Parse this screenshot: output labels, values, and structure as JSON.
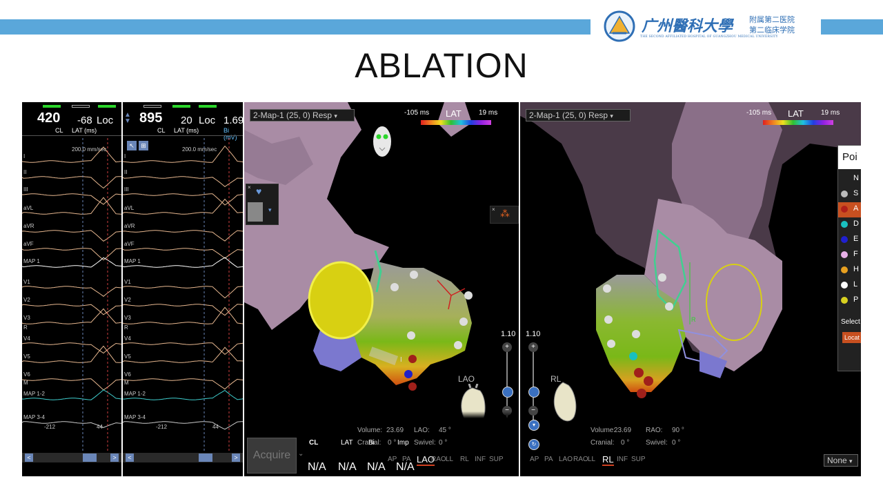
{
  "slide": {
    "title": "ABLATION",
    "logo": {
      "cn_name": "广州醫科大學",
      "cn_sub1": "附属第二医院",
      "cn_sub2": "第二临床学院",
      "en_sub": "THE SECOND AFFILIATED HOSPITAL OF GUANGZHOU MEDICAL UNIVERSITY"
    }
  },
  "ecg_left": {
    "cl_value": "420",
    "cl_label": "CL",
    "lat_value": "-68",
    "lat_label": "LAT (ms)",
    "loc_label": "Loc",
    "speed": "200.0 mm/sec",
    "leads": [
      "I",
      "II",
      "III",
      "aVL",
      "aVR",
      "aVF",
      "MAP 1",
      "V1",
      "V2",
      "V3",
      "R",
      "V4",
      "V5",
      "V6",
      "M",
      "MAP 1-2",
      "MAP 3-4"
    ],
    "footer_left": "-212",
    "footer_right": "44"
  },
  "ecg_right": {
    "cl_value": "895",
    "cl_label": "CL",
    "lat_value": "20",
    "lat_label": "LAT (ms)",
    "loc_label": "Loc",
    "bi_value": "1.69",
    "bi_label": "Bi (mV)",
    "speed": "200.0 mm/sec",
    "leads": [
      "I",
      "II",
      "III",
      "aVL",
      "aVR",
      "aVF",
      "MAP 1",
      "V1",
      "V2",
      "V3",
      "R",
      "V4",
      "V5",
      "V6",
      "M",
      "MAP 1-2",
      "MAP 3-4"
    ],
    "footer_left": "-212",
    "footer_right": "44"
  },
  "map_left": {
    "map_select": "2-Map-1 (25, 0) Resp",
    "lat_min": "-105 ms",
    "lat_label": "LAT",
    "lat_max": "19 ms",
    "zoom": "1.10",
    "orientation": "LAO",
    "volume_label": "Volume:",
    "volume": "23.69",
    "cranial_label": "Cranial:",
    "cranial": "0 °",
    "view_label": "LAO:",
    "view_angle": "45 °",
    "swivel_label": "Swivel:",
    "swivel": "0 °",
    "views": [
      "AP",
      "PA",
      "LAO",
      "RAO",
      "LL",
      "RL",
      "INF",
      "SUP"
    ],
    "active_view": "LAO",
    "acquire": "Acquire",
    "cl_label": "CL",
    "lat_label2": "LAT",
    "bi_label": "Bi",
    "imp_label": "Imp",
    "values": [
      "N/A",
      "N/A",
      "N/A",
      "N/A"
    ],
    "marker": "I"
  },
  "map_right": {
    "map_select": "2-Map-1 (25, 0) Resp",
    "lat_min": "-105 ms",
    "lat_label": "LAT",
    "lat_max": "19 ms",
    "zoom": "1.10",
    "orientation": "RL",
    "volume_label": "Volume:",
    "volume": "23.69",
    "cranial_label": "Cranial:",
    "cranial": "0 °",
    "view_label": "RAO:",
    "view_angle": "90 °",
    "swivel_label": "Swivel:",
    "swivel": "0 °",
    "views": [
      "AP",
      "PA",
      "LAO",
      "RAO",
      "LL",
      "RL",
      "INF",
      "SUP"
    ],
    "active_view": "RL",
    "marker": "R",
    "points_title": "Poi",
    "legend": [
      {
        "label": "N",
        "color": "#000000"
      },
      {
        "label": "S",
        "color": "#bbbbbb"
      },
      {
        "label": "A",
        "color": "#b0201a"
      },
      {
        "label": "D",
        "color": "#19c0c0"
      },
      {
        "label": "E",
        "color": "#2020d0"
      },
      {
        "label": "F",
        "color": "#e8b0e8"
      },
      {
        "label": "H",
        "color": "#e8a020"
      },
      {
        "label": "L",
        "color": "#ffffff"
      },
      {
        "label": "P",
        "color": "#d8d020"
      }
    ],
    "select_label": "Select",
    "locat_label": "Locat",
    "none_select": "None"
  },
  "colors": {
    "band": "#5aa7da",
    "map_bg": "#000000",
    "chamber": "#a98ca5",
    "yellow_ring": "#e8e020"
  }
}
